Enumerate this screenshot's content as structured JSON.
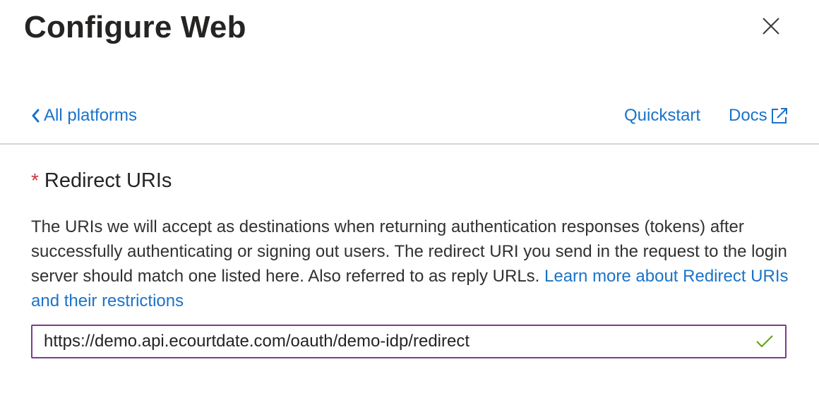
{
  "panel": {
    "title": "Configure Web",
    "close_icon": "close-icon"
  },
  "nav": {
    "back_label": "All platforms",
    "back_icon": "chevron-left-icon",
    "quickstart_label": "Quickstart",
    "docs_label": "Docs",
    "docs_icon": "external-link-icon"
  },
  "redirect": {
    "required_marker": "*",
    "label": "Redirect URIs",
    "description": "The URIs we will accept as destinations when returning authentication responses (tokens) after successfully authenticating or signing out users. The redirect URI you send in the request to the login server should match one listed here. Also referred to as reply URLs. ",
    "learn_more_label": "Learn more about Redirect URIs and their restrictions",
    "uri_value": "https://demo.api.ecourtdate.com/oauth/demo-idp/redirect",
    "valid_icon": "checkmark-icon"
  },
  "colors": {
    "link": "#1a73c9",
    "required": "#d13438",
    "input_border_focus": "#7e3b8f",
    "valid": "#57a300",
    "divider": "#d6d6d6"
  }
}
